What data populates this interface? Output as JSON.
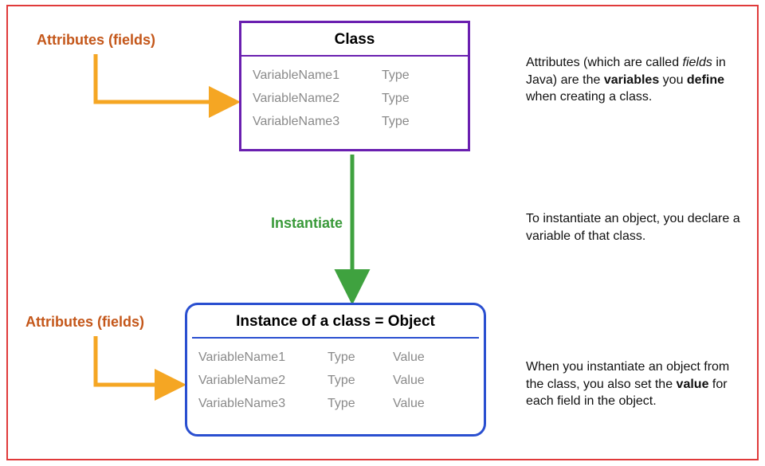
{
  "labels": {
    "attributes_top": "Attributes (fields)",
    "attributes_bottom": "Attributes (fields)",
    "instantiate": "Instantiate"
  },
  "class_box": {
    "title": "Class",
    "rows": [
      {
        "name": "VariableName1",
        "type": "Type"
      },
      {
        "name": "VariableName2",
        "type": "Type"
      },
      {
        "name": "VariableName3",
        "type": "Type"
      }
    ]
  },
  "object_box": {
    "title": "Instance of a class = Object",
    "rows": [
      {
        "name": "VariableName1",
        "type": "Type",
        "value": "Value"
      },
      {
        "name": "VariableName2",
        "type": "Type",
        "value": "Value"
      },
      {
        "name": "VariableName3",
        "type": "Type",
        "value": "Value"
      }
    ]
  },
  "descriptions": {
    "d1_a": "Attributes (which are called ",
    "d1_i": "fields",
    "d1_b": " in Java) are the ",
    "d1_s1": "variables",
    "d1_c": " you ",
    "d1_s2": "define",
    "d1_d": " when creating a class.",
    "d2": "To instantiate an object, you declare a variable of that class.",
    "d3_a": "When you instantiate an object from the class, you also set the ",
    "d3_s": "value",
    "d3_b": " for each field in the object."
  },
  "colors": {
    "orange": "#c4571a",
    "green": "#3a9a3a",
    "purple": "#6a1fb0",
    "blue": "#2a4fd0",
    "yellow_arrow": "#f5a623",
    "green_arrow": "#3fa23f",
    "red_border": "#e03a3a"
  }
}
